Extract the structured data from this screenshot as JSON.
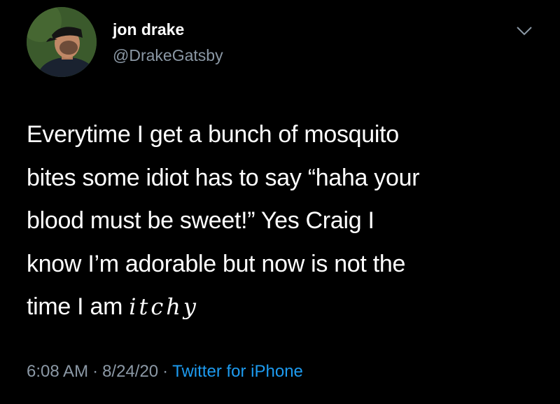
{
  "user": {
    "display_name": "jon drake",
    "handle": "@DrakeGatsby"
  },
  "menu": {
    "icon": "chevron-down-icon"
  },
  "tweet": {
    "lines": [
      "Everytime I get a bunch of mosquito",
      "bites some idiot has to say “haha your",
      "blood must be sweet!” Yes Craig I",
      "know I’m adorable but now is not the"
    ],
    "last_line_prefix": "time I am ",
    "last_line_fancy": "itchy"
  },
  "meta": {
    "time": "6:08 AM",
    "separator": "·",
    "date": "8/24/20",
    "source": "Twitter for iPhone"
  },
  "colors": {
    "background": "#000000",
    "primary_text": "#ffffff",
    "secondary_text": "#8b98a5",
    "link": "#1d9bf0"
  }
}
